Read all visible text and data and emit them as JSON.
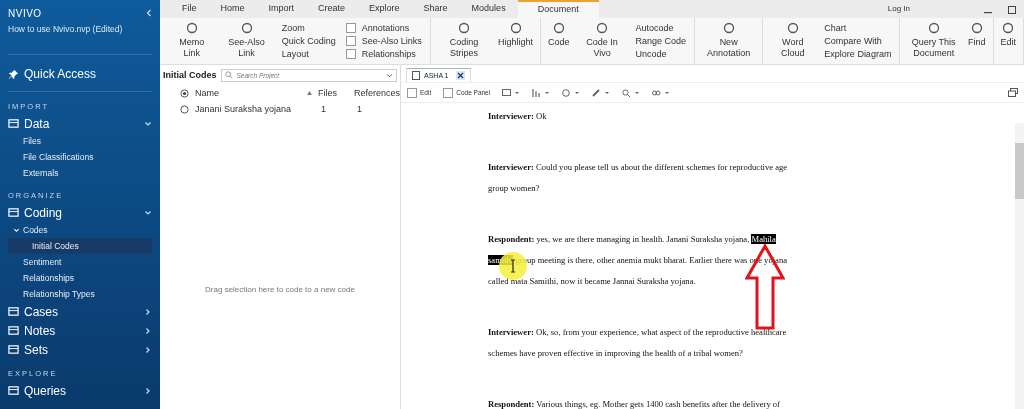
{
  "app": {
    "logo": "NVIVO",
    "project": "How to use Nvivo.nvp (Edited)"
  },
  "sidebar": {
    "quick_access": "Quick Access",
    "sections": [
      {
        "heading": "IMPORT",
        "items": [
          {
            "label": "Data",
            "selected": false,
            "expanded": true,
            "children": [
              {
                "label": "Files",
                "selected": false
              },
              {
                "label": "File Classifications",
                "selected": false
              },
              {
                "label": "Externals",
                "selected": false
              }
            ]
          }
        ]
      },
      {
        "heading": "ORGANIZE",
        "items": [
          {
            "label": "Coding",
            "selected": false,
            "expanded": true,
            "children": [
              {
                "label": "Codes",
                "selected": false,
                "expanded": true,
                "children": [
                  {
                    "label": "Initial Codes",
                    "selected": true
                  }
                ]
              },
              {
                "label": "Sentiment",
                "selected": false
              },
              {
                "label": "Relationships",
                "selected": false
              },
              {
                "label": "Relationship Types",
                "selected": false
              }
            ]
          },
          {
            "label": "Cases",
            "selected": false,
            "expanded": false
          },
          {
            "label": "Notes",
            "selected": false,
            "expanded": false
          },
          {
            "label": "Sets",
            "selected": false,
            "expanded": false
          }
        ]
      },
      {
        "heading": "EXPLORE",
        "items": [
          {
            "label": "Queries",
            "selected": false,
            "expanded": false
          }
        ]
      }
    ]
  },
  "ribbon": {
    "tabs": [
      {
        "label": "File",
        "selected": false
      },
      {
        "label": "Home",
        "selected": false
      },
      {
        "label": "Import",
        "selected": false
      },
      {
        "label": "Create",
        "selected": false
      },
      {
        "label": "Explore",
        "selected": false
      },
      {
        "label": "Share",
        "selected": false
      },
      {
        "label": "Modules",
        "selected": false
      },
      {
        "label": "Document",
        "selected": true
      }
    ],
    "login": "Log In",
    "groups": [
      [
        {
          "kind": "large",
          "label": "Memo Link"
        },
        {
          "kind": "large",
          "label": "See-Also Link"
        },
        {
          "kind": "stack",
          "items": [
            "Zoom",
            "Quick Coding",
            "Layout"
          ]
        },
        {
          "kind": "checks",
          "items": [
            {
              "label": "Annotations",
              "checked": false
            },
            {
              "label": "See-Also Links",
              "checked": false
            },
            {
              "label": "Relationships",
              "checked": false
            }
          ]
        }
      ],
      [
        {
          "kind": "large",
          "label": "Coding Stripes"
        },
        {
          "kind": "large",
          "label": "Highlight"
        }
      ],
      [
        {
          "kind": "large",
          "label": "Code"
        },
        {
          "kind": "large",
          "label": "Code In Vivo"
        },
        {
          "kind": "stack",
          "items": [
            "Autocode",
            "Range Code",
            "Uncode"
          ]
        }
      ],
      [
        {
          "kind": "large",
          "label": "New Annotation"
        }
      ],
      [
        {
          "kind": "large",
          "label": "Word Cloud"
        },
        {
          "kind": "stack",
          "items": [
            "Chart",
            "Compare With",
            "Explore Diagram"
          ]
        }
      ],
      [
        {
          "kind": "large",
          "label": "Query This Document"
        },
        {
          "kind": "large",
          "label": "Find"
        }
      ],
      [
        {
          "kind": "large",
          "label": "Edit"
        }
      ]
    ]
  },
  "codes_panel": {
    "title": "Initial Codes",
    "search_placeholder": "Search Project",
    "columns": [
      "Name",
      "Files",
      "References"
    ],
    "rows": [
      {
        "name": "Janani Suraksha yojana",
        "files": "1",
        "references": "1"
      }
    ],
    "drop_hint": "Drag selection here to code to a new code"
  },
  "document": {
    "tabs": [
      {
        "label": "ASHA 1",
        "selected": true
      }
    ],
    "toolbar": [
      {
        "label": "Edit",
        "checked": false
      },
      {
        "label": "Code Panel",
        "checked": false
      }
    ],
    "paragraphs": [
      {
        "speaker": "Interviewer:",
        "segments": [
          {
            "text": " Ok",
            "selected": false
          }
        ]
      },
      {
        "speaker": "Interviewer:",
        "segments": [
          {
            "text": " Could you please tell us about the different schemes for reproductive age group women?",
            "selected": false
          }
        ]
      },
      {
        "speaker": "Respondent:",
        "segments": [
          {
            "text": " yes, we are there managing in health. Janani Suraksha yojana, ",
            "selected": false
          },
          {
            "text": "Mahila samithi",
            "selected": true
          },
          {
            "text": " group meeting is there, other anemia mukt bharat. Earlier there was one yojana called mata Samithi, now it became Jannai Suraksha yojana.",
            "selected": false
          }
        ]
      },
      {
        "speaker": "Interviewer:",
        "segments": [
          {
            "text": " Ok, so, from your experience, what aspect of the reproductive healthcare schemes have proven effective in improving the health of a tribal women?",
            "selected": false
          }
        ]
      },
      {
        "speaker": "Respondent:",
        "segments": [
          {
            "text": " Various things, eg. Mother gets 1400 cash benefits after the delivery of",
            "selected": false
          }
        ]
      }
    ]
  }
}
